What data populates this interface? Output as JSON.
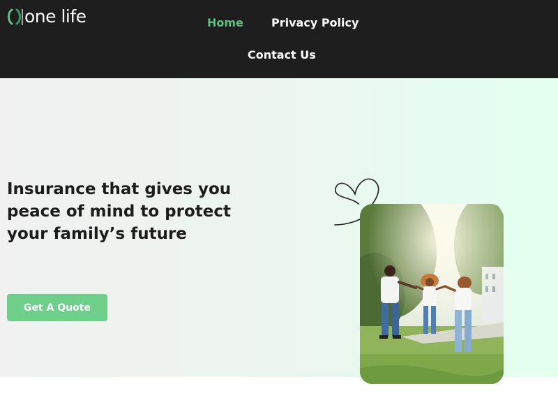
{
  "brand": {
    "name": "one life",
    "logo_icon": "leaf-bracket-logo",
    "accent_color": "#5cc281"
  },
  "nav": {
    "items": [
      {
        "label": "Home",
        "active": true
      },
      {
        "label": "Privacy Policy",
        "active": false
      },
      {
        "label": "Contact Us",
        "active": false
      }
    ]
  },
  "hero": {
    "headline": "Insurance that gives you peace of mind to protect your family’s future",
    "cta_label": "Get A Quote",
    "cta_color": "#6ecf8b",
    "decoration_icon": "heart-outline-icon",
    "image_subject": "family-photo"
  },
  "colors": {
    "header_bg": "#1e1e1e",
    "text_dark": "#1c1c1c"
  }
}
